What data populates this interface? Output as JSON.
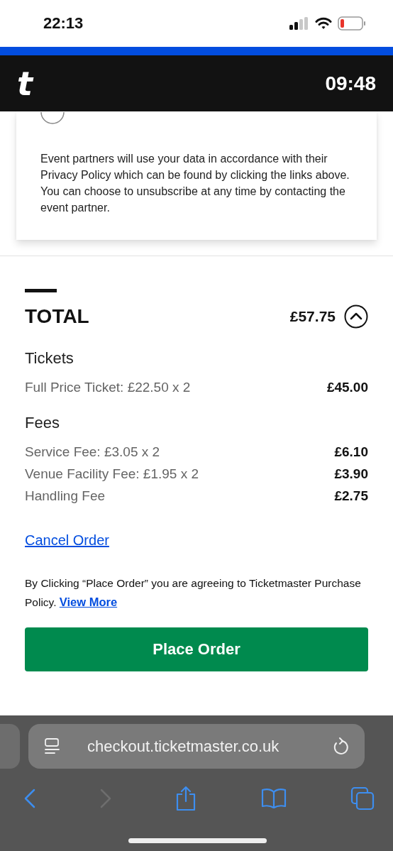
{
  "status_bar": {
    "time": "22:13"
  },
  "header": {
    "logo": "t",
    "timer": "09:48"
  },
  "consent": {
    "option": {
      "selected": false
    },
    "notice": "Event partners will use your data in accordance with their Privacy Policy which can be found by clicking the links above. You can choose to unsubscribe at any time by contacting the event partner."
  },
  "total": {
    "label": "TOTAL",
    "amount": "£57.75",
    "expanded": true
  },
  "sections": [
    {
      "heading": "Tickets",
      "rows": [
        {
          "label": "Full Price Ticket: £22.50 x 2",
          "amount": "£45.00"
        }
      ]
    },
    {
      "heading": "Fees",
      "rows": [
        {
          "label": "Service Fee: £3.05 x 2",
          "amount": "£6.10"
        },
        {
          "label": "Venue Facility Fee: £1.95 x 2",
          "amount": "£3.90"
        },
        {
          "label": "Handling Fee",
          "amount": "£2.75"
        }
      ]
    }
  ],
  "cancel_link": "Cancel Order",
  "terms": {
    "text": "By Clicking “Place Order” you are agreeing to Ticketmaster Purchase Policy.",
    "link": "View More"
  },
  "place_order_button": "Place Order",
  "browser": {
    "url": "checkout.ticketmaster.co.uk"
  }
}
